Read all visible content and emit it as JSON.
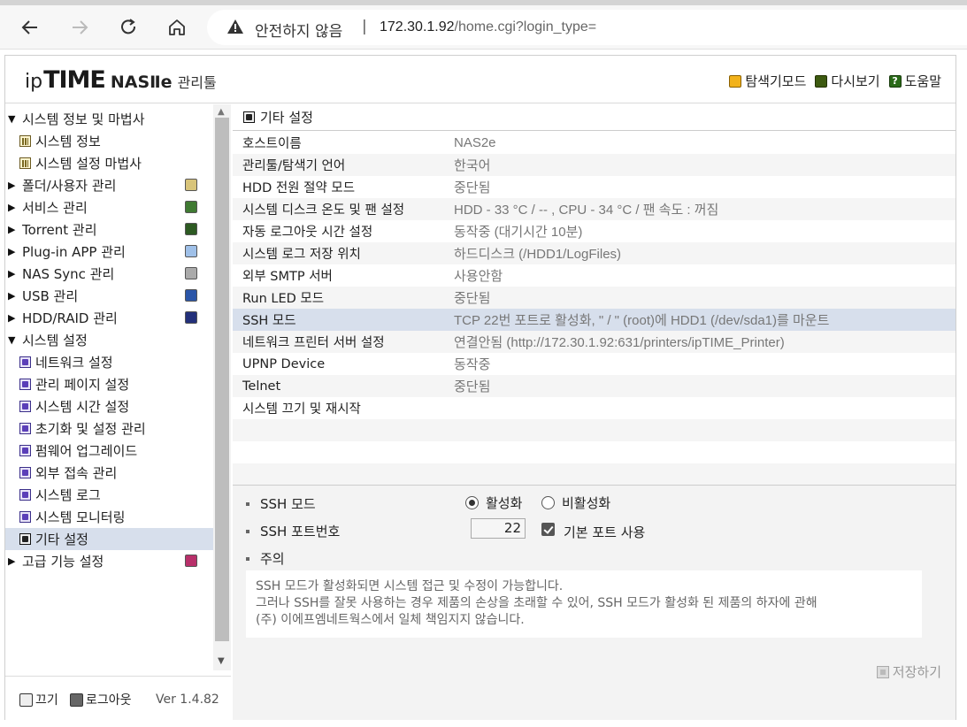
{
  "browser": {
    "security_label": "안전하지 않음",
    "separator": "|",
    "url_host": "172.30.1.92",
    "url_path": "/home.cgi?login_type="
  },
  "header": {
    "logo_ip": "ip",
    "logo_time": "TIME",
    "logo_nas": "NASⅡe",
    "logo_mgr": "관리툴",
    "links": [
      {
        "label": "탐색기모드",
        "icon": "explorer-icon"
      },
      {
        "label": "다시보기",
        "icon": "refresh-icon"
      },
      {
        "label": "도움말",
        "icon": "help-icon"
      }
    ]
  },
  "sidebar": {
    "items": [
      {
        "label": "시스템 정보 및 마법사"
      },
      {
        "label": "시스템 정보"
      },
      {
        "label": "시스템 설정 마법사"
      },
      {
        "label": "폴더/사용자 관리"
      },
      {
        "label": "서비스 관리"
      },
      {
        "label": "Torrent 관리"
      },
      {
        "label": "Plug-in APP 관리"
      },
      {
        "label": "NAS Sync 관리"
      },
      {
        "label": "USB 관리"
      },
      {
        "label": "HDD/RAID 관리"
      },
      {
        "label": "시스템 설정"
      },
      {
        "label": "네트워크 설정"
      },
      {
        "label": "관리 페이지 설정"
      },
      {
        "label": "시스템 시간 설정"
      },
      {
        "label": "초기화 및 설정 관리"
      },
      {
        "label": "펌웨어 업그레이드"
      },
      {
        "label": "외부 접속 관리"
      },
      {
        "label": "시스템 로그"
      },
      {
        "label": "시스템 모니터링"
      },
      {
        "label": "기타 설정"
      },
      {
        "label": "고급 기능 설정"
      }
    ],
    "footer": {
      "power_label": "끄기",
      "logout_label": "로그아웃",
      "version": "Ver 1.4.82"
    }
  },
  "main": {
    "title": "기타 설정",
    "rows": [
      {
        "key": "호스트이름",
        "value": "NAS2e"
      },
      {
        "key": "관리툴/탐색기 언어",
        "value": "한국어"
      },
      {
        "key": "HDD 전원 절약 모드",
        "value": "중단됨"
      },
      {
        "key": "시스템 디스크 온도 및 팬 설정",
        "value": "HDD - 33 °C / -- , CPU - 34 °C / 팬 속도 : 꺼짐"
      },
      {
        "key": "자동 로그아웃 시간 설정",
        "value": "동작중 (대기시간 10분)"
      },
      {
        "key": "시스템 로그 저장 위치",
        "value": "하드디스크 (/HDD1/LogFiles)"
      },
      {
        "key": "외부 SMTP 서버",
        "value": "사용안함"
      },
      {
        "key": "Run LED 모드",
        "value": "중단됨"
      },
      {
        "key": "SSH 모드",
        "value": "TCP 22번 포트로 활성화, \" / \" (root)에 HDD1 (/dev/sda1)를 마운트"
      },
      {
        "key": "네트워크 프린터 서버 설정",
        "value": "연결안됨 (http://172.30.1.92:631/printers/ipTIME_Printer)"
      },
      {
        "key": "UPNP Device",
        "value": "동작중"
      },
      {
        "key": "Telnet",
        "value": "중단됨"
      },
      {
        "key": "시스템 끄기 및 재시작",
        "value": ""
      }
    ],
    "detail": {
      "ssh_mode_label": "SSH 모드",
      "enable_label": "활성화",
      "disable_label": "비활성화",
      "port_label": "SSH 포트번호",
      "port_value": "22",
      "default_port_label": "기본 포트 사용",
      "notice_label": "주의",
      "notice_lines": [
        "SSH 모드가 활성화되면 시스템 접근 및 수정이 가능합니다.",
        "그러나 SSH를 잘못 사용하는 경우 제품의 손상을 초래할 수 있어, SSH 모드가 활성화 된 제품의 하자에 관해",
        "(주) 이에프엠네트웍스에서 일체 책임지지 않습니다."
      ],
      "save_label": "저장하기"
    }
  },
  "colors": {
    "selected_row": "#d7dfec",
    "panel_bg": "#f3f3f3"
  }
}
